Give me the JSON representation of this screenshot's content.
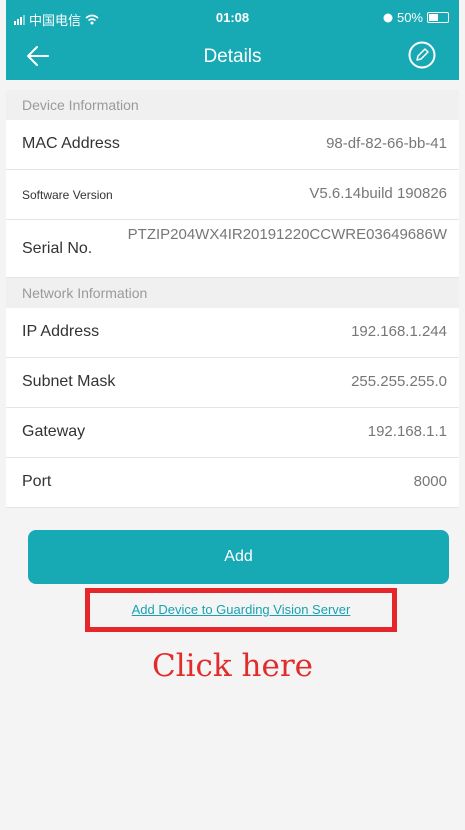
{
  "status_bar": {
    "carrier": "中国电信",
    "time": "01:08",
    "battery": "50%"
  },
  "nav": {
    "title": "Details",
    "back_icon": "arrow-left-icon",
    "edit_icon": "pencil-circle-icon"
  },
  "device_section": {
    "header": "Device Information",
    "rows": [
      {
        "label": "MAC Address",
        "value": "98-df-82-66-bb-41"
      },
      {
        "label": "Software Version",
        "value": "V5.6.14build 190826"
      },
      {
        "label": "Serial No.",
        "value": "PTZIP204WX4IR20191220CCWRE03649686W"
      }
    ]
  },
  "network_section": {
    "header": "Network Information",
    "rows": [
      {
        "label": "IP Address",
        "value": "192.168.1.244"
      },
      {
        "label": "Subnet Mask",
        "value": "255.255.255.0"
      },
      {
        "label": "Gateway",
        "value": "192.168.1.1"
      },
      {
        "label": "Port",
        "value": "8000"
      }
    ]
  },
  "actions": {
    "add_label": "Add",
    "guard_link": "Add Device to Guarding Vision Server"
  },
  "annotation": {
    "text": "Click here"
  },
  "colors": {
    "accent": "#17aab5",
    "highlight": "#e5262b"
  }
}
